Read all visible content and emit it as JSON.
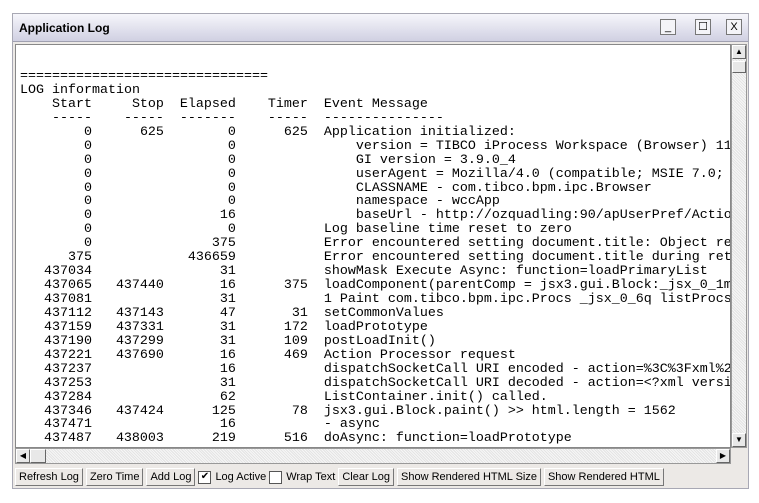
{
  "window": {
    "title": "Application Log",
    "minimize": "_",
    "maximize": "☐",
    "close": "X"
  },
  "log": {
    "separator": "===============================",
    "heading": "LOG information",
    "columns": {
      "start": "Start",
      "stop": "Stop",
      "elapsed": "Elapsed",
      "timer": "Timer",
      "message": "Event Message"
    },
    "underline": {
      "start": "-----",
      "stop": "-----",
      "elapsed": "-------",
      "timer": "-----",
      "message": "---------------"
    },
    "rows": [
      {
        "start": "0",
        "stop": "625",
        "elapsed": "0",
        "timer": "625",
        "message": "Application initialized:"
      },
      {
        "start": "0",
        "stop": "",
        "elapsed": "0",
        "timer": "",
        "message": "    version = TIBCO iProcess Workspace (Browser) 11"
      },
      {
        "start": "0",
        "stop": "",
        "elapsed": "0",
        "timer": "",
        "message": "    GI version = 3.9.0_4"
      },
      {
        "start": "0",
        "stop": "",
        "elapsed": "0",
        "timer": "",
        "message": "    userAgent = Mozilla/4.0 (compatible; MSIE 7.0; "
      },
      {
        "start": "0",
        "stop": "",
        "elapsed": "0",
        "timer": "",
        "message": "    CLASSNAME - com.tibco.bpm.ipc.Browser"
      },
      {
        "start": "0",
        "stop": "",
        "elapsed": "0",
        "timer": "",
        "message": "    namespace - wccApp"
      },
      {
        "start": "0",
        "stop": "",
        "elapsed": "16",
        "timer": "",
        "message": "    baseUrl - http://ozquadling:90/apUserPref/Actio"
      },
      {
        "start": "0",
        "stop": "",
        "elapsed": "0",
        "timer": "",
        "message": "Log baseline time reset to zero"
      },
      {
        "start": "0",
        "stop": "",
        "elapsed": "375",
        "timer": "",
        "message": "Error encountered setting document.title: Object re"
      },
      {
        "start": "375",
        "stop": "",
        "elapsed": "436659",
        "timer": "",
        "message": "Error encountered setting document.title during ret"
      },
      {
        "start": "437034",
        "stop": "",
        "elapsed": "31",
        "timer": "",
        "message": "showMask Execute Async: function=loadPrimaryList"
      },
      {
        "start": "437065",
        "stop": "437440",
        "elapsed": "16",
        "timer": "375",
        "message": "loadComponent(parentComp = jsx3.gui.Block:_jsx_0_1m"
      },
      {
        "start": "437081",
        "stop": "",
        "elapsed": "31",
        "timer": "",
        "message": "1 Paint com.tibco.bpm.ipc.Procs _jsx_0_6q listProcs"
      },
      {
        "start": "437112",
        "stop": "437143",
        "elapsed": "47",
        "timer": "31",
        "message": "setCommonValues"
      },
      {
        "start": "437159",
        "stop": "437331",
        "elapsed": "31",
        "timer": "172",
        "message": "loadPrototype"
      },
      {
        "start": "437190",
        "stop": "437299",
        "elapsed": "31",
        "timer": "109",
        "message": "postLoadInit()"
      },
      {
        "start": "437221",
        "stop": "437690",
        "elapsed": "16",
        "timer": "469",
        "message": "Action Processor request"
      },
      {
        "start": "437237",
        "stop": "",
        "elapsed": "16",
        "timer": "",
        "message": "dispatchSocketCall URI encoded - action=%3C%3Fxml%2"
      },
      {
        "start": "437253",
        "stop": "",
        "elapsed": "31",
        "timer": "",
        "message": "dispatchSocketCall URI decoded - action=<?xml versi"
      },
      {
        "start": "437284",
        "stop": "",
        "elapsed": "62",
        "timer": "",
        "message": "ListContainer.init() called."
      },
      {
        "start": "437346",
        "stop": "437424",
        "elapsed": "125",
        "timer": "78",
        "message": "jsx3.gui.Block.paint() >> html.length = 1562"
      },
      {
        "start": "437471",
        "stop": "",
        "elapsed": "16",
        "timer": "",
        "message": "- async"
      },
      {
        "start": "437487",
        "stop": "438003",
        "elapsed": "219",
        "timer": "516",
        "message": "doAsync: function=loadPrototype"
      }
    ]
  },
  "toolbar": {
    "refresh": "Refresh Log",
    "zero": "Zero Time",
    "add": "Add Log",
    "log_active": {
      "label": "Log Active",
      "checked": true
    },
    "wrap_text": {
      "label": "Wrap Text",
      "checked": false
    },
    "clear": "Clear Log",
    "html_size": "Show Rendered HTML Size",
    "html": "Show Rendered HTML"
  }
}
